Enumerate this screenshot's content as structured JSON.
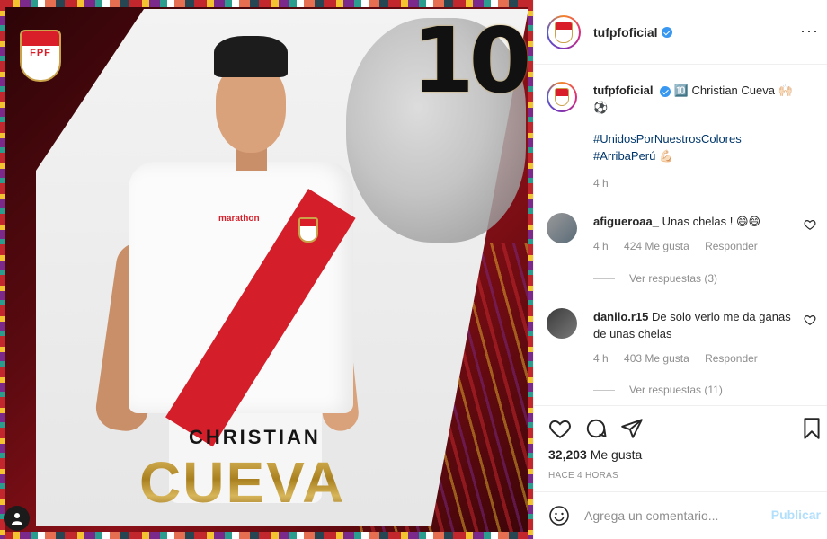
{
  "post": {
    "image_alt": "",
    "jersey_number": "10",
    "name_first": "CHRISTIAN",
    "name_last": "CUEVA",
    "logo_text": "FPF",
    "sponsor_text": "marathon"
  },
  "header": {
    "username": "tufpfoficial",
    "more_icon": "more-options-icon",
    "more_symbol": "···"
  },
  "caption": {
    "username": "tufpfoficial",
    "text": "🔟 Christian Cueva 🙌🏻⚽",
    "hashtag1": "#UnidosPorNuestrosColores",
    "hashtag2": "#ArribaPerú",
    "hashtag2_emoji": "💪🏻",
    "time": "4 h"
  },
  "comments": [
    {
      "username": "afigueroaa_",
      "text": "Unas chelas ! 😄😄",
      "time": "4 h",
      "likes": "424 Me gusta",
      "reply": "Responder",
      "view_replies": "Ver respuestas (3)"
    },
    {
      "username": "danilo.r15",
      "text": "De solo verlo me da ganas de unas chelas",
      "time": "4 h",
      "likes": "403 Me gusta",
      "reply": "Responder",
      "view_replies": "Ver respuestas (11)"
    }
  ],
  "actions": {
    "likes_number": "32,203",
    "likes_label": "Me gusta",
    "posted_ago": "HACE 4 HORAS"
  },
  "composer": {
    "placeholder": "Agrega un comentario...",
    "publish_label": "Publicar"
  },
  "colors": {
    "accent": "#3897f0",
    "link": "#00376b",
    "muted": "#8e8e8e",
    "peru_red": "#d91e2a",
    "gold": "#b48b2b"
  }
}
